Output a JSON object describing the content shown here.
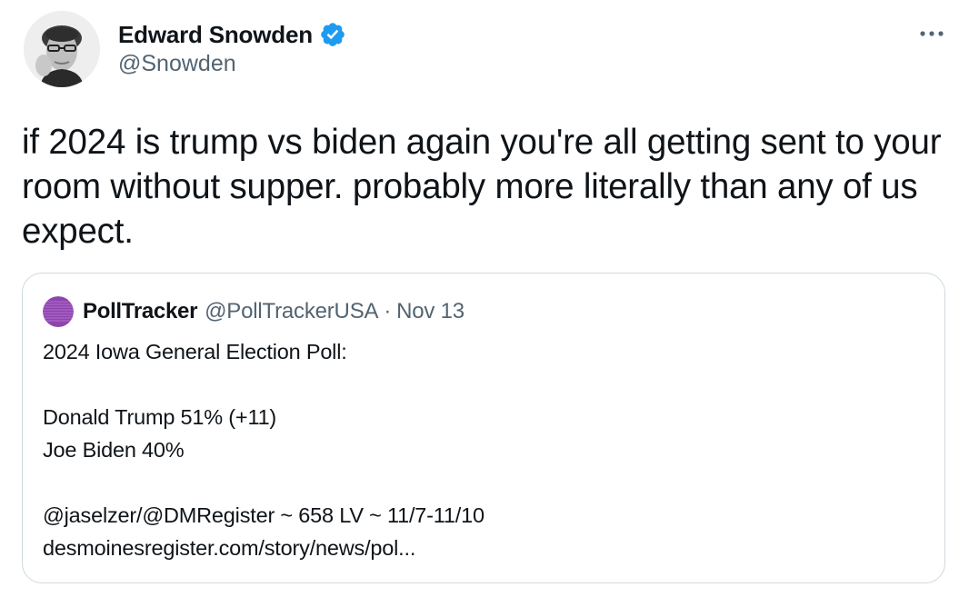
{
  "tweet": {
    "author": {
      "name": "Edward Snowden",
      "handle": "@Snowden",
      "verified": true,
      "avatar_icon": "profile-photo"
    },
    "more_icon": "ellipsis-icon",
    "text": "if 2024 is trump vs biden again you're all getting sent to your room without supper. probably more literally than any of us expect."
  },
  "quote": {
    "author": {
      "name": "PollTracker",
      "handle": "@PollTrackerUSA",
      "separator": "·",
      "date": "Nov 13",
      "avatar_color": "#8e44ad"
    },
    "lines": [
      "2024 Iowa General Election Poll:",
      "",
      "Donald Trump 51% (+11)",
      "Joe Biden 40%",
      "",
      "@jaselzer/@DMRegister ~ 658 LV ~ 11/7-11/10",
      "desmoinesregister.com/story/news/pol..."
    ]
  },
  "colors": {
    "text_primary": "#0f1419",
    "text_secondary": "#536471",
    "verified_blue": "#1d9bf0",
    "border": "#cfd9de"
  }
}
